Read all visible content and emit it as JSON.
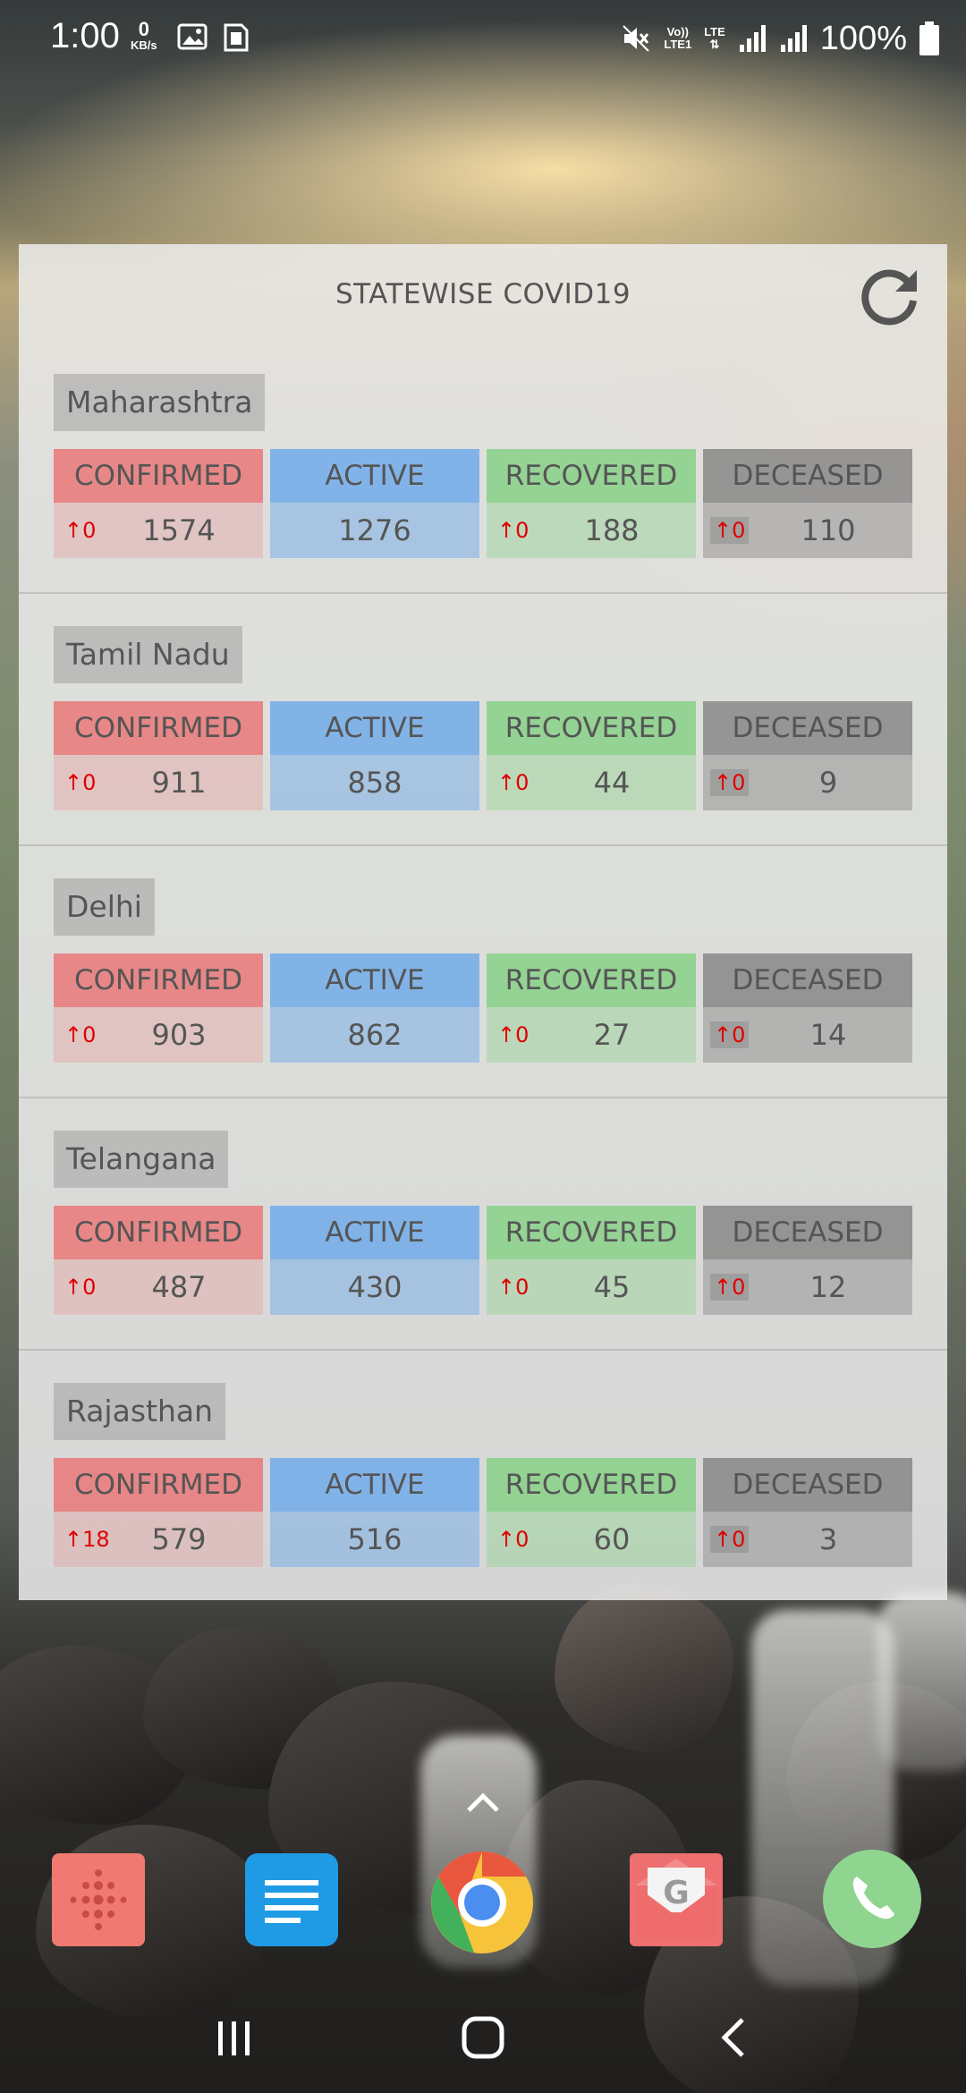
{
  "status_bar": {
    "time": "1:00",
    "net_speed_value": "0",
    "net_speed_unit": "KB/s",
    "volte_label_top": "Vo))",
    "volte_label_bottom": "LTE1",
    "lte_label": "LTE",
    "battery": "100%"
  },
  "widget": {
    "title": "STATEWISE COVID19",
    "refresh_icon": "refresh-icon",
    "labels": {
      "confirmed": "CONFIRMED",
      "active": "ACTIVE",
      "recovered": "RECOVERED",
      "deceased": "DECEASED"
    },
    "states": [
      {
        "name": "Maharashtra",
        "confirmed": "1574",
        "confirmed_delta": "↑0",
        "active": "1276",
        "recovered": "188",
        "recovered_delta": "↑0",
        "deceased": "110",
        "deceased_delta": "↑0"
      },
      {
        "name": "Tamil Nadu",
        "confirmed": "911",
        "confirmed_delta": "↑0",
        "active": "858",
        "recovered": "44",
        "recovered_delta": "↑0",
        "deceased": "9",
        "deceased_delta": "↑0"
      },
      {
        "name": "Delhi",
        "confirmed": "903",
        "confirmed_delta": "↑0",
        "active": "862",
        "recovered": "27",
        "recovered_delta": "↑0",
        "deceased": "14",
        "deceased_delta": "↑0"
      },
      {
        "name": "Telangana",
        "confirmed": "487",
        "confirmed_delta": "↑0",
        "active": "430",
        "recovered": "45",
        "recovered_delta": "↑0",
        "deceased": "12",
        "deceased_delta": "↑0"
      },
      {
        "name": "Rajasthan",
        "confirmed": "579",
        "confirmed_delta": "↑18",
        "active": "516",
        "recovered": "60",
        "recovered_delta": "↑0",
        "deceased": "3",
        "deceased_delta": "↑0"
      }
    ],
    "colors": {
      "confirmed": "#e87d7d",
      "active": "#7aafe8",
      "recovered": "#8cd28c",
      "deceased": "#828282",
      "delta": "#e00000"
    }
  },
  "dock": {
    "apps": [
      "fitbit-app-icon",
      "docs-app-icon",
      "chrome-app-icon",
      "gmail-app-icon",
      "phone-app-icon"
    ]
  },
  "navigation": {
    "recents": "recents-icon",
    "home": "home-icon",
    "back": "back-icon"
  }
}
